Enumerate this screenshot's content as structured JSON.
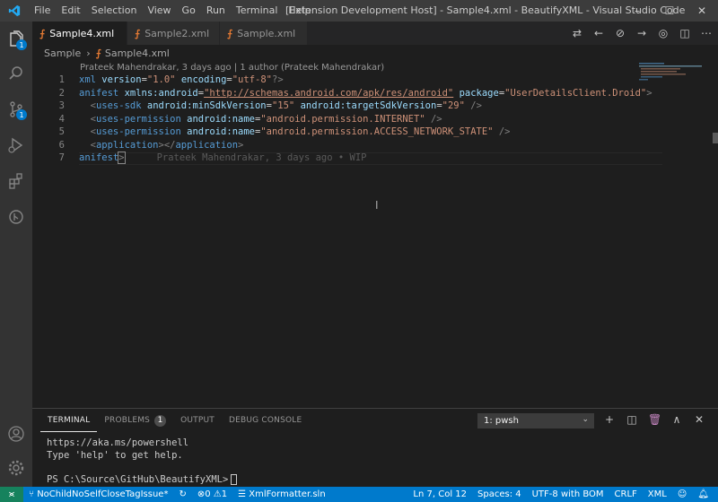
{
  "window": {
    "title": "[Extension Development Host] - Sample4.xml - BeautifyXML - Visual Studio Code",
    "menu": [
      "File",
      "Edit",
      "Selection",
      "View",
      "Go",
      "Run",
      "Terminal",
      "Help"
    ]
  },
  "activity": {
    "source_control_badge": "1",
    "explorer_badge": "1"
  },
  "tabs": [
    {
      "label": "Sample4.xml",
      "active": true
    },
    {
      "label": "Sample2.xml",
      "active": false
    },
    {
      "label": "Sample.xml",
      "active": false
    }
  ],
  "breadcrumb": {
    "folder": "Sample",
    "file": "Sample4.xml"
  },
  "editor": {
    "codelens": "Prateek Mahendrakar, 3 days ago | 1 author (Prateek Mahendrakar)",
    "line_numbers": [
      "1",
      "2",
      "3",
      "4",
      "5",
      "6",
      "7"
    ],
    "lines": {
      "l1": {
        "a": "xml ",
        "b": "version",
        "c": "=",
        "d": "\"1.0\"",
        "e": " ",
        "f": "encoding",
        "g": "=",
        "h": "\"utf-8\"",
        "i": "?>"
      },
      "l2": {
        "a": "anifest ",
        "b": "xmlns:android",
        "c": "=",
        "d": "\"http://schemas.android.com/apk/res/android\"",
        "e": " ",
        "f": "package",
        "g": "=",
        "h": "\"UserDetailsClient.Droid\"",
        "i": ">"
      },
      "l3": {
        "a": "  <",
        "b": "uses-sdk",
        "c": " ",
        "d": "android:minSdkVersion",
        "e": "=",
        "f": "\"15\"",
        "g": " ",
        "h": "android:targetSdkVersion",
        "i": "=",
        "j": "\"29\"",
        "k": " />"
      },
      "l4": {
        "a": "  <",
        "b": "uses-permission",
        "c": " ",
        "d": "android:name",
        "e": "=",
        "f": "\"android.permission.INTERNET\"",
        "g": " />"
      },
      "l5": {
        "a": "  <",
        "b": "uses-permission",
        "c": " ",
        "d": "android:name",
        "e": "=",
        "f": "\"android.permission.ACCESS_NETWORK_STATE\"",
        "g": " />"
      },
      "l6": {
        "a": "  <",
        "b": "application",
        "c": "></",
        "d": "application",
        "e": ">"
      },
      "l7": {
        "a": "anifest",
        "b": ">"
      }
    },
    "blame": "Prateek Mahendrakar, 3 days ago • WIP"
  },
  "panel": {
    "tabs": [
      "TERMINAL",
      "PROBLEMS",
      "OUTPUT",
      "DEBUG CONSOLE"
    ],
    "problems_count": "1",
    "terminal_select": "1: pwsh",
    "terminal_lines": [
      "https://aka.ms/powershell",
      "Type 'help' to get help.",
      "",
      "PS C:\\Source\\GitHub\\BeautifyXML>"
    ]
  },
  "status": {
    "branch": "NoChildNoSelfCloseTagIssue*",
    "errors": "0",
    "warnings": "1",
    "solution": "XmlFormatter.sln",
    "position": "Ln 7, Col 12",
    "spaces": "Spaces: 4",
    "encoding": "UTF-8 with BOM",
    "eol": "CRLF",
    "language": "XML"
  },
  "colors": {
    "accent": "#007acc",
    "titlebar": "#3c3c3c",
    "activitybar": "#333333",
    "editor_bg": "#1e1e1e",
    "xml_tag": "#569cd6",
    "xml_attr": "#9cdcfe",
    "xml_string": "#ce9178",
    "rss_icon": "#e37933"
  }
}
